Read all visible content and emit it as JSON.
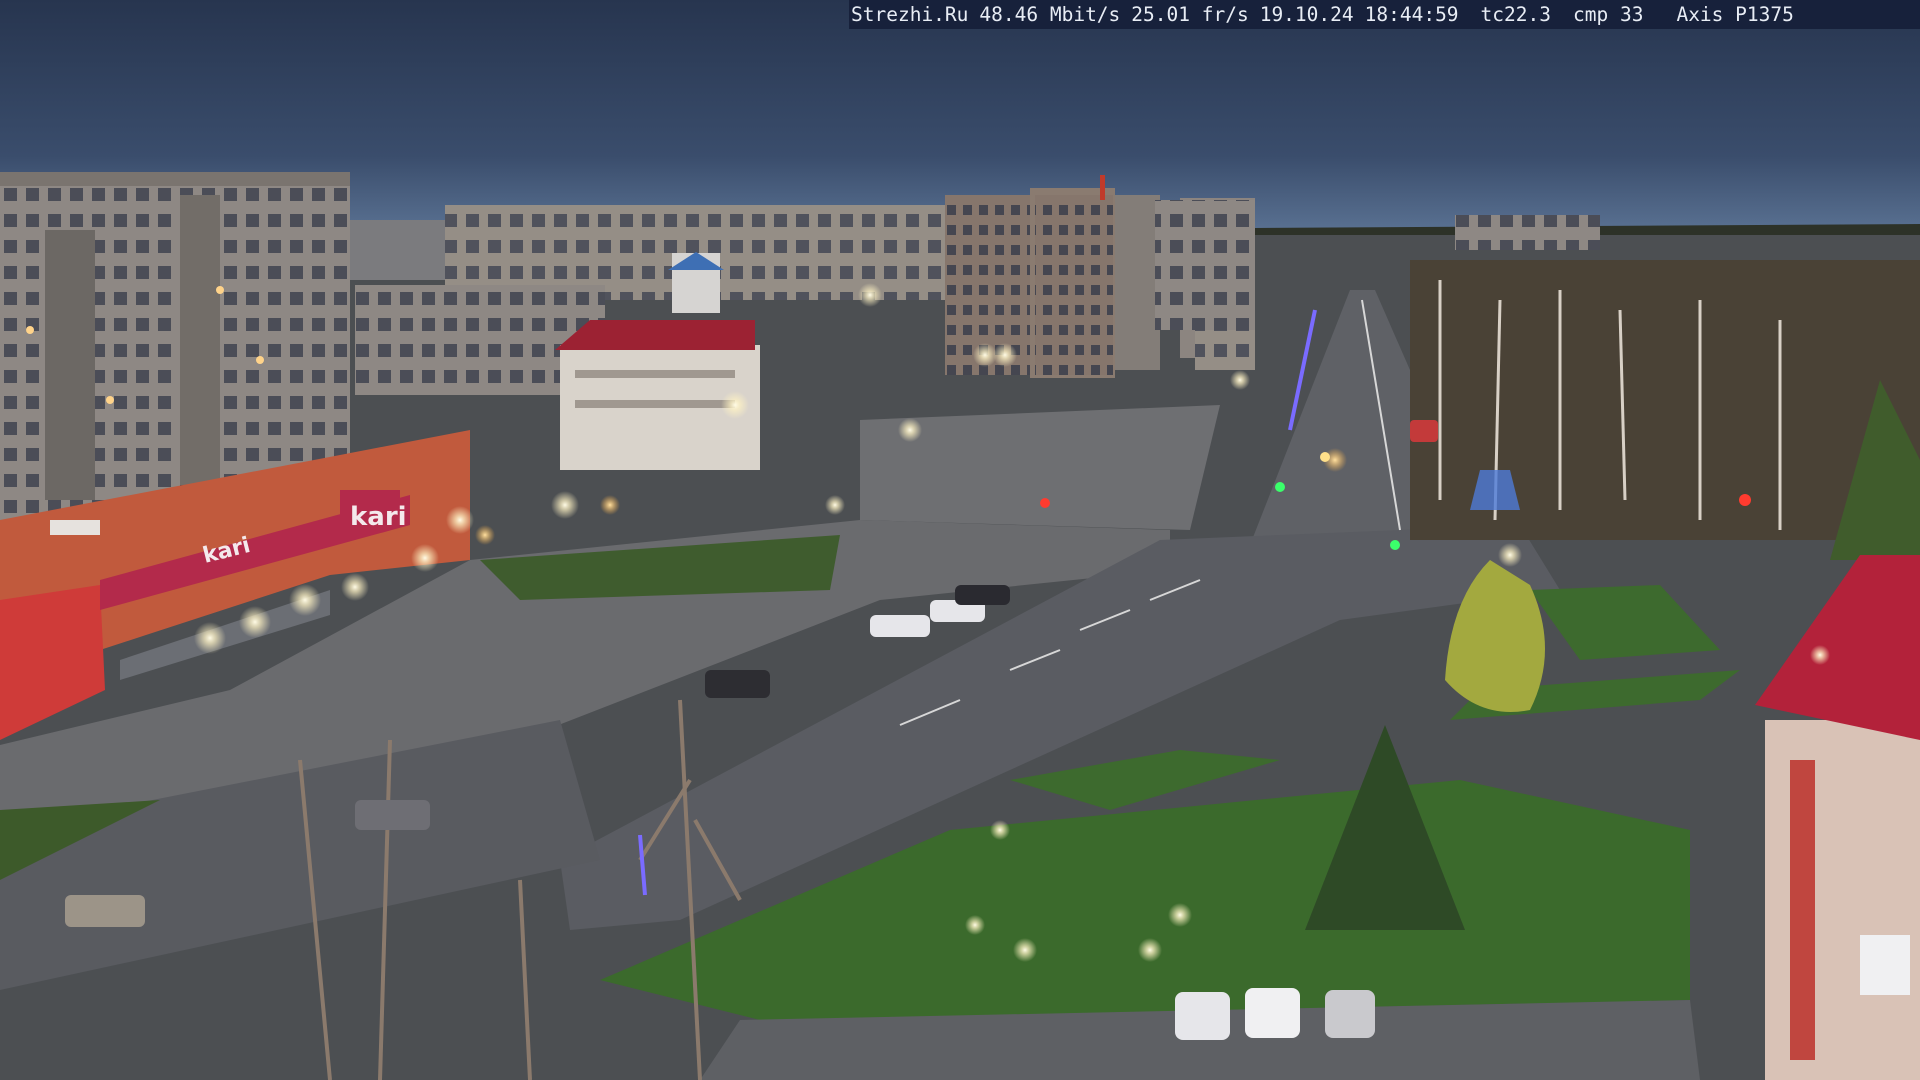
{
  "osd": {
    "site": "Strezhi.Ru",
    "bitrate": "48.46 Mbit/s",
    "framerate": "25.01 fr/s",
    "date": "19.10.24",
    "time": "18:44:59",
    "tc": "tc22.3",
    "cmp": "cmp 33",
    "camera": "Axis P1375"
  },
  "signs": {
    "store_logo": "kari",
    "store_logo_small": "kari"
  },
  "colors": {
    "sky_top": "#2b3a55",
    "sky_horizon": "#5d7596",
    "osd_background": "#16203a",
    "osd_text": "#e8edf5",
    "building_panel": "#8f8a86",
    "store_facade": "#c55a3c",
    "store_sign": "#b32a4b",
    "roof_red": "#b3223a",
    "grass": "#3d6a2e",
    "asphalt": "#5a5c62",
    "street_light": "#fffbe6"
  }
}
